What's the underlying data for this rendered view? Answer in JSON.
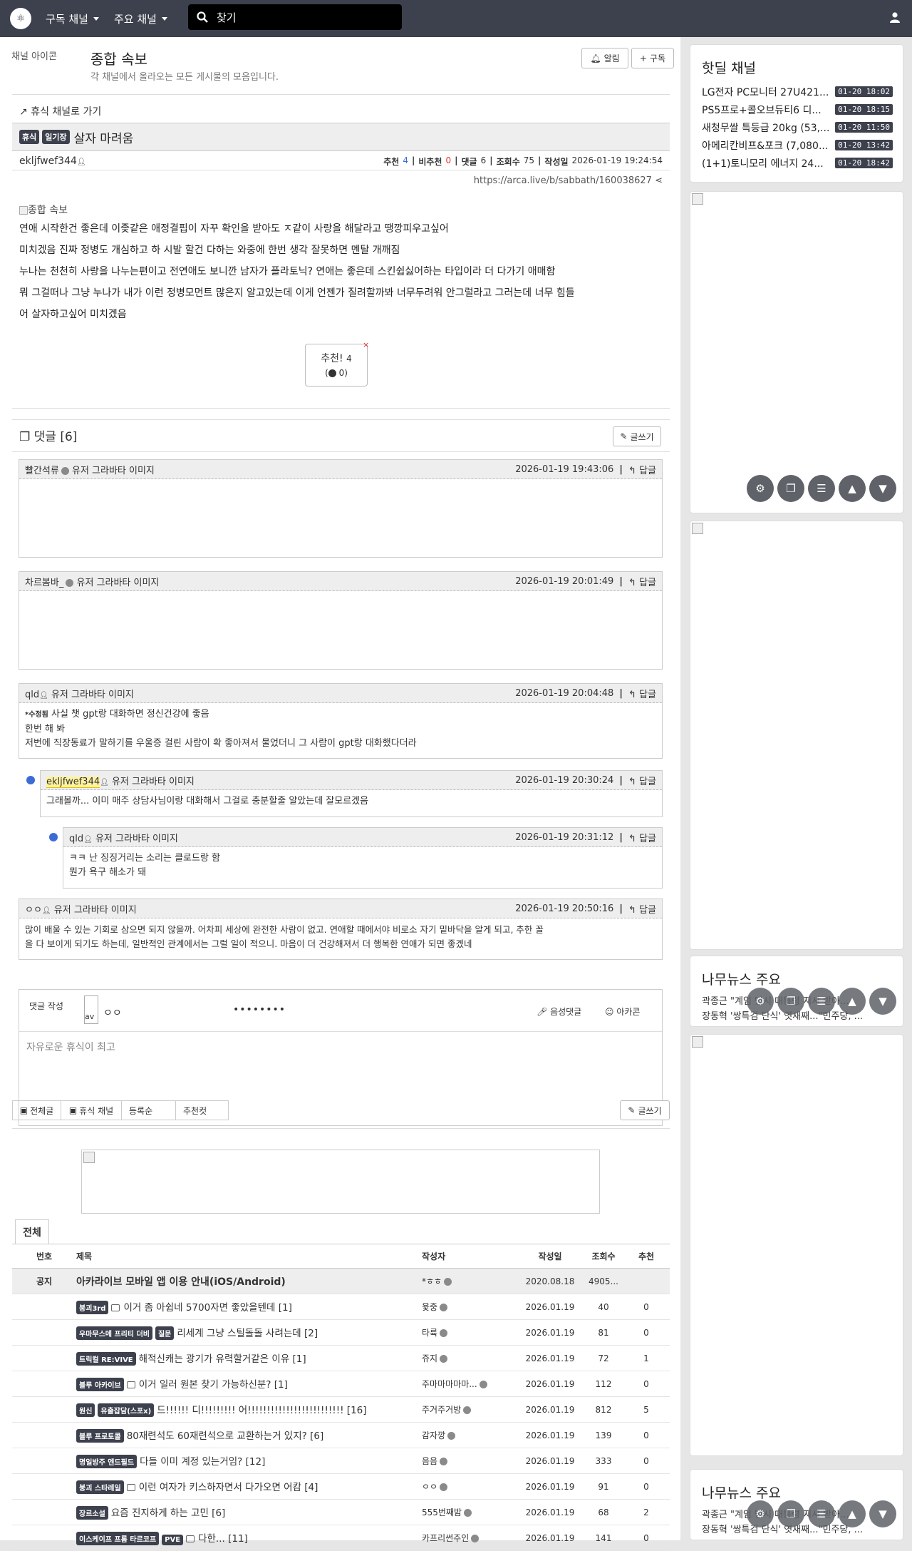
{
  "nav": {
    "logo": "⚛",
    "subscribed": "구독 채널",
    "main": "주요 채널",
    "search_placeholder": "찾기"
  },
  "board": {
    "icon_alt": "채널 아이콘",
    "title": "종합 속보",
    "desc": "각 채널에서 올라오는 모든 게시물의 모음입니다.",
    "notify": "알림",
    "subscribe": "구독"
  },
  "post": {
    "back": "휴식 채널로 가기",
    "badge1": "휴식",
    "badge2": "일기장",
    "title": "살자 마려움",
    "author": "ekljfwef344",
    "rec_label": "추천",
    "rec": "4",
    "unrec_label": "비추천",
    "unrec": "0",
    "cmt_label": "댓글",
    "cmt": "6",
    "view_label": "조회수",
    "views": "75",
    "date_label": "작성일",
    "date": "2026-01-19 19:24:54",
    "url": "https://arca.live/b/sabbath/160038627",
    "img_alt": "종합 속보",
    "lines": [
      "연애 시작한건 좋은데 이좆같은 애정결핍이 자꾸 확인을 받아도 ㅈ같이 사랑을 해달라고 땡깡피우고싶어",
      "미치겠음 진짜 정병도 개심하고 하 시발 할건 다하는 와중에 한번 생각 잘못하면 멘탈 개깨짐",
      "누나는 천천히 사랑을 나누는편이고 전연애도 보니깐 남자가 플라토닉? 연애는 좋은데 스킨쉽싫어하는 타입이라 더 다가기 애매함",
      "뭐 그걸떠나 그냥 누나가 내가 이런 정병모먼트 많은지 알고있는데 이게 언젠가 질려할까봐 너무두려워 안그럴라고 그러는데 너무 힘들",
      "어 살자하고싶어 미치겠음"
    ],
    "rec_btn": "추천!",
    "rec_btn_count": "4",
    "rec_sub": "0"
  },
  "comments": {
    "title": "댓글 [6]",
    "write": "글쓰기",
    "avatar_alt": "유저 그라바타 이미지",
    "reply": "답글",
    "items": [
      {
        "user": "빨간석류",
        "date": "2026-01-19 19:43:06",
        "lines": []
      },
      {
        "user": "차르봄바_",
        "date": "2026-01-19 20:01:49",
        "lines": []
      },
      {
        "user": "qld",
        "date": "2026-01-19 20:04:48",
        "edited": "*수정됨",
        "lines": [
          "사실 챗 gpt랑 대화하면 정신건강에 좋음",
          "한번 해 봐",
          "저번에 직장동료가 말하기를 우울증 걸린 사람이 확 좋아져서 물었더니 그 사람이 gpt랑 대화했다더라"
        ]
      },
      {
        "user": "ekljfwef344",
        "date": "2026-01-19 20:30:24",
        "lines": [
          "그래볼까... 이미 매주 상담사님이랑 대화해서 그걸로 충분할줄 알았는데 잘모르겠음"
        ]
      },
      {
        "user": "qld",
        "date": "2026-01-19 20:31:12",
        "lines": [
          "ㅋㅋ 난 징징거리는 소리는 클로드랑 함",
          "뭔가 욕구 해소가 돼"
        ]
      },
      {
        "user": "ㅇㅇ",
        "date": "2026-01-19 20:50:16",
        "lines": [
          "많이 배울 수 있는 기회로 삼으면 되지 않을까. 어차피 세상에 완전한 사람이 없고. 연애할 때에서야 비로소 자기 밑바닥을 알게 되고, 추한 꼴",
          "을 다 보이게 되기도 하는데, 일반적인 관계에서는 그럴 일이 적으니. 마음이 더 건강해져서 더 행복한 연애가 되면 좋겠네"
        ]
      }
    ]
  },
  "compose": {
    "label": "댓글 작성",
    "avatar_alt": "av",
    "nick": "ㅇㅇ",
    "password": "••••••••",
    "voice": "음성댓글",
    "emoticon": "아카콘",
    "placeholder": "자유로운 휴식이 최고"
  },
  "list_tabs": {
    "all": "전체글",
    "channel": "휴식 채널",
    "sort1": "등록순",
    "sort2": "추천컷",
    "write": "글쓰기",
    "tab": "전체"
  },
  "table": {
    "headers": [
      "번호",
      "제목",
      "작성자",
      "작성일",
      "조회수",
      "추천"
    ],
    "notice": {
      "no": "공지",
      "title": "아카라이브 모바일 앱 이용 안내(iOS/Android)",
      "author": "*ㅎㅎ",
      "date": "2020.08.18",
      "views": "4905...",
      "rec": ""
    },
    "rows": [
      {
        "badges": [
          "붕괴3rd"
        ],
        "icon": true,
        "title": "이거 좀 아쉽네 5700자면 좋았을텐데 [1]",
        "author": "윷중",
        "date": "2026.01.19",
        "views": "40",
        "rec": "0"
      },
      {
        "badges": [
          "우마무스메 프리티 더비",
          "질문"
        ],
        "icon": false,
        "title": "리세계 그냥 스틸돌돌 사려는데 [2]",
        "author": "타륙",
        "date": "2026.01.19",
        "views": "81",
        "rec": "0"
      },
      {
        "badges": [
          "트릭컬 RE:VIVE"
        ],
        "icon": false,
        "title": "해적신캐는 광기가 유력할거같은 이유 [1]",
        "author": "쥬지",
        "date": "2026.01.19",
        "views": "72",
        "rec": "1"
      },
      {
        "badges": [
          "블루 아카이브"
        ],
        "icon": true,
        "title": "이거 일러 원본 찾기 가능하신분? [1]",
        "author": "주마마마마마...",
        "date": "2026.01.19",
        "views": "112",
        "rec": "0"
      },
      {
        "badges": [
          "원신",
          "유출잡담(스포x)"
        ],
        "icon": false,
        "title": "드!!!!!! 디!!!!!!!!! 어!!!!!!!!!!!!!!!!!!!!!!!!! [16]",
        "author": "주거주거방",
        "date": "2026.01.19",
        "views": "812",
        "rec": "5"
      },
      {
        "badges": [
          "블루 프로토콜"
        ],
        "icon": false,
        "title": "80재련석도 60재련석으로 교환하는거 있지? [6]",
        "author": "감자깡",
        "date": "2026.01.19",
        "views": "139",
        "rec": "0"
      },
      {
        "badges": [
          "명일방주 엔드필드"
        ],
        "icon": false,
        "title": "다들 이미 계정 있는거임? [12]",
        "author": "음음",
        "date": "2026.01.19",
        "views": "333",
        "rec": "0"
      },
      {
        "badges": [
          "붕괴 스타레일"
        ],
        "icon": true,
        "title": "이런 여자가 키스하자면서 다가오면 어캄 [4]",
        "author": "ㅇㅇ",
        "date": "2026.01.19",
        "views": "91",
        "rec": "0"
      },
      {
        "badges": [
          "장르소설"
        ],
        "icon": false,
        "title": "요즘 진지하게 하는 고민 [6]",
        "author": "555번째밤",
        "date": "2026.01.19",
        "views": "68",
        "rec": "2"
      },
      {
        "badges": [
          "이스케이프 프롬 타르코프",
          "PVE"
        ],
        "icon": true,
        "title": "다한... [11]",
        "author": "카프리썬주인",
        "date": "2026.01.19",
        "views": "141",
        "rec": "0"
      }
    ]
  },
  "sidebar": {
    "hot_title": "핫딜 채널",
    "hot": [
      {
        "t": "LG전자 PC모니터 27U421...",
        "d": "01-20 18:02"
      },
      {
        "t": "PS5프로+콜오브듀티6 디...",
        "d": "01-20 18:15"
      },
      {
        "t": "새청무쌀 특등급 20kg (53,...",
        "d": "01-20 11:50"
      },
      {
        "t": "아메리칸비프&포크 (7,080...",
        "d": "01-20 13:42"
      },
      {
        "t": "(1+1)토니모리 에너지 24...",
        "d": "01-20 18:42"
      }
    ],
    "news_title": "나무뉴스 주요",
    "news": [
      "곽종근 \"계엄 당시 대통령 지시 받아...",
      "장동혁 '쌍특검 단식' 엿새째...\"민주당, ..."
    ]
  },
  "colors": {
    "nav": "#3d414d",
    "accent": "#3d6bd6",
    "red": "#e03131"
  }
}
